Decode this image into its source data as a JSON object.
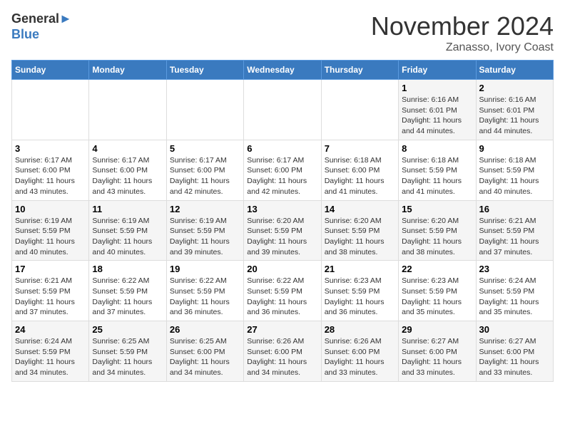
{
  "logo": {
    "line1": "General",
    "line2": "Blue"
  },
  "title": "November 2024",
  "location": "Zanasso, Ivory Coast",
  "weekdays": [
    "Sunday",
    "Monday",
    "Tuesday",
    "Wednesday",
    "Thursday",
    "Friday",
    "Saturday"
  ],
  "weeks": [
    [
      {
        "day": "",
        "info": ""
      },
      {
        "day": "",
        "info": ""
      },
      {
        "day": "",
        "info": ""
      },
      {
        "day": "",
        "info": ""
      },
      {
        "day": "",
        "info": ""
      },
      {
        "day": "1",
        "info": "Sunrise: 6:16 AM\nSunset: 6:01 PM\nDaylight: 11 hours and 44 minutes."
      },
      {
        "day": "2",
        "info": "Sunrise: 6:16 AM\nSunset: 6:01 PM\nDaylight: 11 hours and 44 minutes."
      }
    ],
    [
      {
        "day": "3",
        "info": "Sunrise: 6:17 AM\nSunset: 6:00 PM\nDaylight: 11 hours and 43 minutes."
      },
      {
        "day": "4",
        "info": "Sunrise: 6:17 AM\nSunset: 6:00 PM\nDaylight: 11 hours and 43 minutes."
      },
      {
        "day": "5",
        "info": "Sunrise: 6:17 AM\nSunset: 6:00 PM\nDaylight: 11 hours and 42 minutes."
      },
      {
        "day": "6",
        "info": "Sunrise: 6:17 AM\nSunset: 6:00 PM\nDaylight: 11 hours and 42 minutes."
      },
      {
        "day": "7",
        "info": "Sunrise: 6:18 AM\nSunset: 6:00 PM\nDaylight: 11 hours and 41 minutes."
      },
      {
        "day": "8",
        "info": "Sunrise: 6:18 AM\nSunset: 5:59 PM\nDaylight: 11 hours and 41 minutes."
      },
      {
        "day": "9",
        "info": "Sunrise: 6:18 AM\nSunset: 5:59 PM\nDaylight: 11 hours and 40 minutes."
      }
    ],
    [
      {
        "day": "10",
        "info": "Sunrise: 6:19 AM\nSunset: 5:59 PM\nDaylight: 11 hours and 40 minutes."
      },
      {
        "day": "11",
        "info": "Sunrise: 6:19 AM\nSunset: 5:59 PM\nDaylight: 11 hours and 40 minutes."
      },
      {
        "day": "12",
        "info": "Sunrise: 6:19 AM\nSunset: 5:59 PM\nDaylight: 11 hours and 39 minutes."
      },
      {
        "day": "13",
        "info": "Sunrise: 6:20 AM\nSunset: 5:59 PM\nDaylight: 11 hours and 39 minutes."
      },
      {
        "day": "14",
        "info": "Sunrise: 6:20 AM\nSunset: 5:59 PM\nDaylight: 11 hours and 38 minutes."
      },
      {
        "day": "15",
        "info": "Sunrise: 6:20 AM\nSunset: 5:59 PM\nDaylight: 11 hours and 38 minutes."
      },
      {
        "day": "16",
        "info": "Sunrise: 6:21 AM\nSunset: 5:59 PM\nDaylight: 11 hours and 37 minutes."
      }
    ],
    [
      {
        "day": "17",
        "info": "Sunrise: 6:21 AM\nSunset: 5:59 PM\nDaylight: 11 hours and 37 minutes."
      },
      {
        "day": "18",
        "info": "Sunrise: 6:22 AM\nSunset: 5:59 PM\nDaylight: 11 hours and 37 minutes."
      },
      {
        "day": "19",
        "info": "Sunrise: 6:22 AM\nSunset: 5:59 PM\nDaylight: 11 hours and 36 minutes."
      },
      {
        "day": "20",
        "info": "Sunrise: 6:22 AM\nSunset: 5:59 PM\nDaylight: 11 hours and 36 minutes."
      },
      {
        "day": "21",
        "info": "Sunrise: 6:23 AM\nSunset: 5:59 PM\nDaylight: 11 hours and 36 minutes."
      },
      {
        "day": "22",
        "info": "Sunrise: 6:23 AM\nSunset: 5:59 PM\nDaylight: 11 hours and 35 minutes."
      },
      {
        "day": "23",
        "info": "Sunrise: 6:24 AM\nSunset: 5:59 PM\nDaylight: 11 hours and 35 minutes."
      }
    ],
    [
      {
        "day": "24",
        "info": "Sunrise: 6:24 AM\nSunset: 5:59 PM\nDaylight: 11 hours and 34 minutes."
      },
      {
        "day": "25",
        "info": "Sunrise: 6:25 AM\nSunset: 5:59 PM\nDaylight: 11 hours and 34 minutes."
      },
      {
        "day": "26",
        "info": "Sunrise: 6:25 AM\nSunset: 6:00 PM\nDaylight: 11 hours and 34 minutes."
      },
      {
        "day": "27",
        "info": "Sunrise: 6:26 AM\nSunset: 6:00 PM\nDaylight: 11 hours and 34 minutes."
      },
      {
        "day": "28",
        "info": "Sunrise: 6:26 AM\nSunset: 6:00 PM\nDaylight: 11 hours and 33 minutes."
      },
      {
        "day": "29",
        "info": "Sunrise: 6:27 AM\nSunset: 6:00 PM\nDaylight: 11 hours and 33 minutes."
      },
      {
        "day": "30",
        "info": "Sunrise: 6:27 AM\nSunset: 6:00 PM\nDaylight: 11 hours and 33 minutes."
      }
    ]
  ]
}
